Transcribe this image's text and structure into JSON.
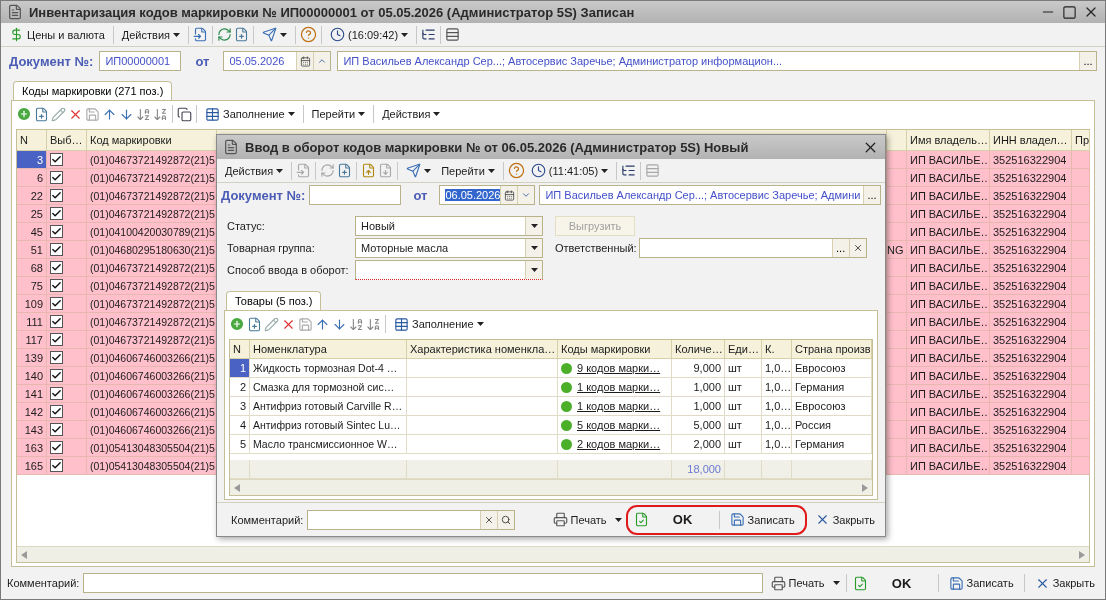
{
  "window": {
    "title": "Инвентаризация кодов маркировки № ИП00000001 от 05.05.2026 (Администратор 5S) Записан"
  },
  "toolbar": {
    "prices": "Цены и валюта",
    "actions": "Действия",
    "time": "(16:09:42)"
  },
  "document": {
    "label": "Документ №:",
    "number": "ИП00000001",
    "date_label": "от",
    "date": "05.05.2026",
    "organization": "ИП Васильев Александр Сер...; Автосервис Заречье; Администратор информацион...",
    "select_button": "..."
  },
  "tabs": [
    {
      "label": "Коды маркировки (271 поз.)",
      "selected": true
    }
  ],
  "table_toolbar": {
    "fill": "Заполнение",
    "goto": "Перейти",
    "actions": "Действия"
  },
  "table": {
    "columns": [
      {
        "label": "N"
      },
      {
        "label": "Выб…"
      },
      {
        "label": "Код маркировки"
      },
      {
        "label": "Имя владель…"
      },
      {
        "label": "ИНН владел…"
      },
      {
        "label": "Пр"
      }
    ],
    "rows": [
      {
        "n": "3",
        "selected": true,
        "checked": true,
        "code": "(01)04673721492872(21)5",
        "owner": "ИП ВАСИЛЬЕ…",
        "inn": "352516322904"
      },
      {
        "n": "6",
        "selected": false,
        "checked": true,
        "code": "(01)04673721492872(21)5",
        "owner": "ИП ВАСИЛЬЕ…",
        "inn": "352516322904"
      },
      {
        "n": "22",
        "selected": false,
        "checked": true,
        "code": "(01)04673721492872(21)5",
        "owner": "ИП ВАСИЛЬЕ…",
        "inn": "352516322904"
      },
      {
        "n": "25",
        "selected": false,
        "checked": true,
        "code": "(01)04673721492872(21)5",
        "owner": "ИП ВАСИЛЬЕ…",
        "inn": "352516322904"
      },
      {
        "n": "45",
        "selected": false,
        "checked": true,
        "code": "(01)04100420030789(21)5",
        "owner": "ИП ВАСИЛЬЕ…",
        "inn": "352516322904"
      },
      {
        "n": "51",
        "selected": false,
        "checked": true,
        "code": "(01)04680295180630(21)5",
        "column_4": "NG",
        "owner": "ИП ВАСИЛЬЕ…",
        "inn": "352516322904"
      },
      {
        "n": "68",
        "selected": false,
        "checked": true,
        "code": "(01)04673721492872(21)5",
        "owner": "ИП ВАСИЛЬЕ…",
        "inn": "352516322904"
      },
      {
        "n": "75",
        "selected": false,
        "checked": true,
        "code": "(01)04673721492872(21)5",
        "owner": "ИП ВАСИЛЬЕ…",
        "inn": "352516322904"
      },
      {
        "n": "109",
        "selected": false,
        "checked": true,
        "code": "(01)04673721492872(21)5",
        "owner": "ИП ВАСИЛЬЕ…",
        "inn": "352516322904"
      },
      {
        "n": "111",
        "selected": false,
        "checked": true,
        "code": "(01)04673721492872(21)5",
        "owner": "ИП ВАСИЛЬЕ…",
        "inn": "352516322904"
      },
      {
        "n": "117",
        "selected": false,
        "checked": true,
        "code": "(01)04673721492872(21)5",
        "owner": "ИП ВАСИЛЬЕ…",
        "inn": "352516322904"
      },
      {
        "n": "139",
        "selected": false,
        "checked": true,
        "code": "(01)04606746003266(21)5",
        "owner": "ИП ВАСИЛЬЕ…",
        "inn": "352516322904"
      },
      {
        "n": "140",
        "selected": false,
        "checked": true,
        "code": "(01)04606746003266(21)5",
        "owner": "ИП ВАСИЛЬЕ…",
        "inn": "352516322904"
      },
      {
        "n": "141",
        "selected": false,
        "checked": true,
        "code": "(01)04606746003266(21)5",
        "owner": "ИП ВАСИЛЬЕ…",
        "inn": "352516322904"
      },
      {
        "n": "142",
        "selected": false,
        "checked": true,
        "code": "(01)04606746003266(21)5",
        "owner": "ИП ВАСИЛЬЕ…",
        "inn": "352516322904"
      },
      {
        "n": "143",
        "selected": false,
        "checked": true,
        "code": "(01)04606746003266(21)5",
        "owner": "ИП ВАСИЛЬЕ…",
        "inn": "352516322904"
      },
      {
        "n": "163",
        "selected": false,
        "checked": true,
        "code": "(01)05413048305504(21)5",
        "owner": "ИП ВАСИЛЬЕ…",
        "inn": "352516322904"
      },
      {
        "n": "165",
        "selected": false,
        "checked": true,
        "code": "(01)05413048305504(21)5",
        "owner": "ИП ВАСИЛЬЕ…",
        "inn": "352516322904"
      }
    ]
  },
  "footer": {
    "comment_label": "Комментарий:",
    "print": "Печать",
    "ok": "OK",
    "save": "Записать",
    "close": "Закрыть"
  },
  "dialog": {
    "title": "Ввод в оборот кодов маркировки №  от 06.05.2026 (Администратор 5S) Новый",
    "toolbar": {
      "actions": "Действия",
      "goto": "Перейти",
      "time": "(11:41:05)"
    },
    "document": {
      "label": "Документ №:",
      "date_label": "от",
      "date": "06.05.2026",
      "date_selected": true,
      "organization": "ИП Васильев Александр Сер...; Автосервис Заречье; Админи",
      "select_button": "..."
    },
    "fields": [
      {
        "label": "Статус:",
        "value": "Новый",
        "required": false
      },
      {
        "label": "Товарная группа:",
        "value": "Моторные масла",
        "required": false
      },
      {
        "label": "Способ ввода в оборот:",
        "required": true
      }
    ],
    "unload_button": {
      "label": "Выгрузить",
      "disabled": true
    },
    "responsible": {
      "label": "Ответственный:",
      "select_button": "..."
    },
    "tabs": [
      {
        "label": "Товары (5 поз.)",
        "selected": true
      }
    ],
    "table_toolbar": {
      "fill": "Заполнение"
    },
    "table": {
      "columns": [
        {
          "label": "N"
        },
        {
          "label": "Номенклатура"
        },
        {
          "label": "Характеристика номенкла…"
        },
        {
          "label": "Коды маркировки"
        },
        {
          "label": "Количе…"
        },
        {
          "label": "Еди…"
        },
        {
          "label": "К."
        },
        {
          "label": "Страна произв"
        }
      ],
      "rows": [
        {
          "n": "1",
          "selected": true,
          "name": "Жидкость тормозная Dot-4 …",
          "codes": "9 кодов марки…",
          "color": "#4caf2a",
          "quantity": "9,000",
          "unit": "шт",
          "k": "1,0…",
          "country": "Евросоюз"
        },
        {
          "n": "2",
          "selected": false,
          "name": "Смазка для тормозной сис…",
          "codes": "1 кодов марки…",
          "color": "#4caf2a",
          "quantity": "1,000",
          "unit": "шт",
          "k": "1,0…",
          "country": "Германия"
        },
        {
          "n": "3",
          "selected": false,
          "name": "Антифриз готовый Carville R…",
          "codes": "1 кодов марки…",
          "color": "#4caf2a",
          "quantity": "1,000",
          "unit": "шт",
          "k": "1,0…",
          "country": "Евросоюз"
        },
        {
          "n": "4",
          "selected": false,
          "name": "Антифриз готовый Sintec Lu…",
          "codes": "5 кодов марки…",
          "color": "#4caf2a",
          "quantity": "5,000",
          "unit": "шт",
          "k": "1,0…",
          "country": "Россия"
        },
        {
          "n": "5",
          "selected": false,
          "name": "Масло трансмиссионное W…",
          "codes": "2 кодов марки…",
          "color": "#4caf2a",
          "quantity": "2,000",
          "unit": "шт",
          "k": "1,0…",
          "country": "Германия"
        }
      ],
      "total_quantity": "18,000"
    },
    "footer": {
      "comment_label": "Комментарий:",
      "print": "Печать",
      "ok": "OK",
      "save": "Записать",
      "close": "Закрыть",
      "highlight": true
    }
  }
}
